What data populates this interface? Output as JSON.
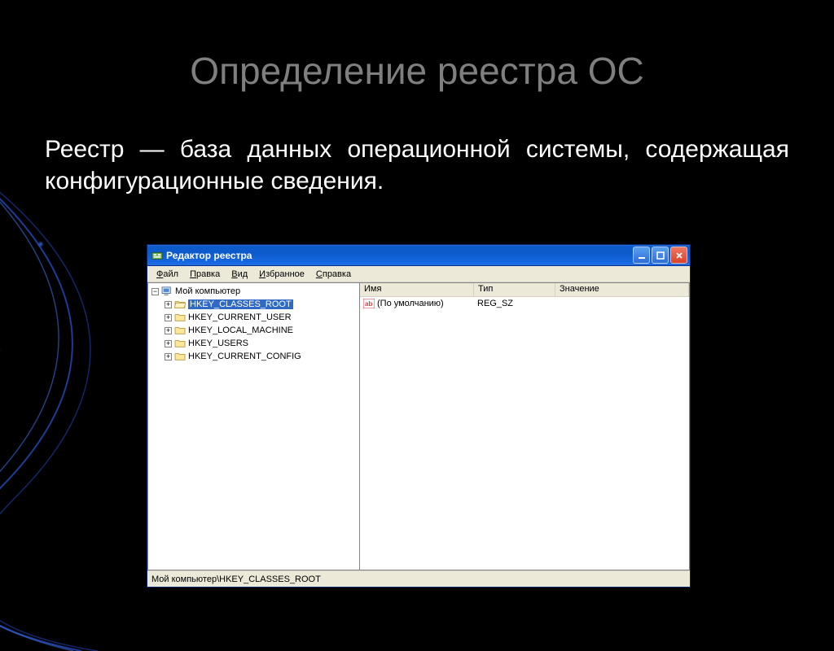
{
  "slide": {
    "title": "Определение реестра ОС",
    "body": "Реестр — база данных операционной системы, содержащая конфигурационные сведения."
  },
  "window": {
    "title": "Редактор реестра",
    "menu": [
      "Файл",
      "Правка",
      "Вид",
      "Избранное",
      "Справка"
    ],
    "tree": {
      "root": "Мой компьютер",
      "selected": "HKEY_CLASSES_ROOT",
      "items": [
        "HKEY_CLASSES_ROOT",
        "HKEY_CURRENT_USER",
        "HKEY_LOCAL_MACHINE",
        "HKEY_USERS",
        "HKEY_CURRENT_CONFIG"
      ]
    },
    "columns": {
      "name": "Имя",
      "type": "Тип",
      "value": "Значение"
    },
    "rows": [
      {
        "name": "(По умолчанию)",
        "type": "REG_SZ",
        "value": ""
      }
    ],
    "status": "Мой компьютер\\HKEY_CLASSES_ROOT"
  }
}
